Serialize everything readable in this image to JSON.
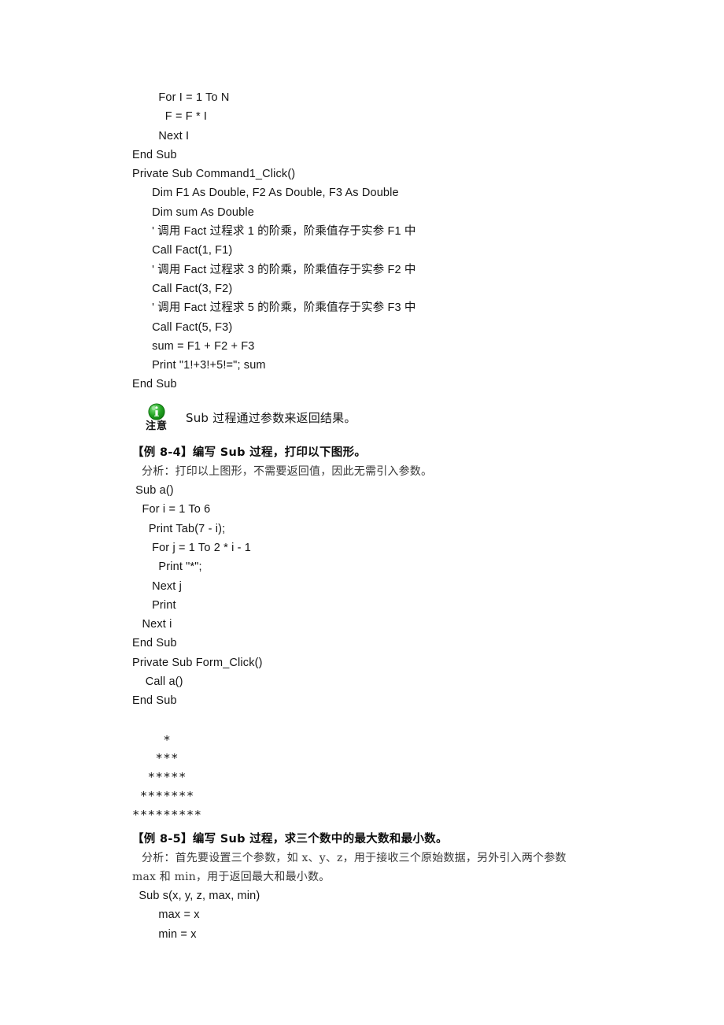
{
  "document": {
    "page_background": "#ffffff",
    "text_color": "#151515"
  },
  "code_block_1": {
    "name": "fact-and-command1-click-code",
    "lines": [
      "        For I = 1 To N",
      "          F = F * I",
      "        Next I",
      "End Sub",
      "Private Sub Command1_Click()",
      "      Dim F1 As Double, F2 As Double, F3 As Double",
      "      Dim sum As Double"
    ],
    "comment_1": "      ' 调用 Fact 过程求 1 的阶乘，阶乘值存于实参 F1 中",
    "line_call_1": "      Call Fact(1, F1)",
    "comment_2": "      ' 调用 Fact 过程求 3 的阶乘，阶乘值存于实参 F2 中",
    "line_call_2": "      Call Fact(3, F2)",
    "comment_3": "      ' 调用 Fact 过程求 5 的阶乘，阶乘值存于实参 F3 中",
    "line_call_3": "      Call Fact(5, F3)",
    "line_sum": "      sum = F1 + F2 + F3",
    "line_print": "      Print \"1!+3!+5!=\"; sum",
    "line_end": "End Sub"
  },
  "note": {
    "icon": "info-circle-green-icon",
    "icon_color": "#1ea01e",
    "label": "注意",
    "text": "Sub 过程通过参数来返回结果。"
  },
  "example_8_4": {
    "heading": "【例 8-4】编写 Sub 过程，打印以下图形。",
    "analysis": "分析：打印以上图形，不需要返回值，因此无需引入参数。",
    "code_lines": [
      " Sub a()",
      "   For i = 1 To 6",
      "     Print Tab(7 - i);",
      "      For j = 1 To 2 * i - 1",
      "        Print \"*\";",
      "      Next j",
      "      Print",
      "   Next i",
      "End Sub",
      "Private Sub Form_Click()",
      "    Call a()",
      "End Sub"
    ],
    "output_pattern": [
      "    *",
      "   ***",
      "  *****",
      " *******",
      "*********"
    ]
  },
  "example_8_5": {
    "heading": "【例 8-5】编写 Sub 过程，求三个数中的最大数和最小数。",
    "analysis_line_1": "分析：首先要设置三个参数，如 x、y、z，用于接收三个原始数据，另外引入两个参数",
    "analysis_line_2": "max 和 min，用于返回最大和最小数。",
    "code_lines": [
      "  Sub s(x, y, z, max, min)",
      "        max = x",
      "        min = x"
    ]
  }
}
